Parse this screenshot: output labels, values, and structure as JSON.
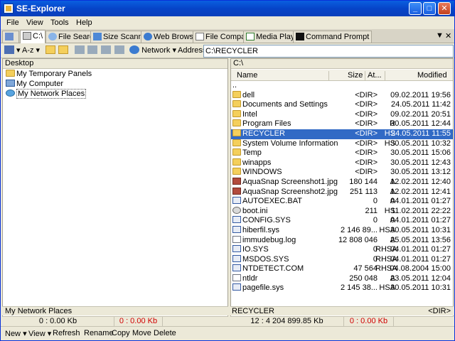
{
  "window": {
    "title": "SE-Explorer",
    "min": "_",
    "max": "□",
    "close": "✕"
  },
  "menu": [
    "File",
    "View",
    "Tools",
    "Help"
  ],
  "tabs": [
    {
      "label": "C:\\",
      "icon": "drive-icon",
      "active": true
    },
    {
      "label": "File Search",
      "icon": "search-icon"
    },
    {
      "label": "Size Scanner",
      "icon": "scanner-icon"
    },
    {
      "label": "Web Browser",
      "icon": "globe-icon"
    },
    {
      "label": "File Compare",
      "icon": "compare-icon"
    },
    {
      "label": "Media Player",
      "icon": "media-icon"
    },
    {
      "label": "Command Prompt",
      "icon": "cmd-icon"
    }
  ],
  "tabbar_controls": {
    "chevron": "▼",
    "close": "✕"
  },
  "toolbar": {
    "sort": "A-z",
    "network": "Network",
    "address_label": "Address",
    "address_value": "C:\\RECYCLER"
  },
  "left_pane": {
    "header": "Desktop",
    "items": [
      {
        "label": "My Temporary Panels",
        "icon": "folder-icon"
      },
      {
        "label": "My Computer",
        "icon": "computer-icon"
      },
      {
        "label": "My Network Places",
        "icon": "network-icon",
        "selected": true
      }
    ],
    "status_name": "My Network Places",
    "status_count": "0 : 0.00 Kb",
    "status_selected": "0 : 0.00 Kb"
  },
  "right_pane": {
    "header": "C:\\",
    "columns": {
      "name": "Name",
      "size": "Size",
      "attr": "At...",
      "modified": "Modified"
    },
    "parent": "..",
    "rows": [
      {
        "name": "dell",
        "icon": "folder",
        "size": "<DIR>",
        "attr": "",
        "modified": "09.02.2011 19:56"
      },
      {
        "name": "Documents and Settings",
        "icon": "folder",
        "size": "<DIR>",
        "attr": "",
        "modified": "24.05.2011 11:42"
      },
      {
        "name": "Intel",
        "icon": "folder",
        "size": "<DIR>",
        "attr": "",
        "modified": "09.02.2011 20:51"
      },
      {
        "name": "Program Files",
        "icon": "folder",
        "size": "<DIR>",
        "attr": "R",
        "modified": "30.05.2011 12:44"
      },
      {
        "name": "RECYCLER",
        "icon": "folder",
        "size": "<DIR>",
        "attr": "HS",
        "modified": "24.05.2011 11:55",
        "selected": true
      },
      {
        "name": "System Volume Information",
        "icon": "folder",
        "size": "<DIR>",
        "attr": "HS",
        "modified": "30.05.2011 10:32"
      },
      {
        "name": "Temp",
        "icon": "folder",
        "size": "<DIR>",
        "attr": "",
        "modified": "30.05.2011 15:06"
      },
      {
        "name": "winapps",
        "icon": "folder",
        "size": "<DIR>",
        "attr": "",
        "modified": "30.05.2011 12:43"
      },
      {
        "name": "WINDOWS",
        "icon": "folder",
        "size": "<DIR>",
        "attr": "",
        "modified": "30.05.2011 13:12"
      },
      {
        "name": "AquaSnap Screenshot1.jpg",
        "icon": "img",
        "size": "180 144",
        "attr": "A",
        "modified": "12.02.2011 12:40"
      },
      {
        "name": "AquaSnap Screenshot2.jpg",
        "icon": "img",
        "size": "251 113",
        "attr": "A",
        "modified": "12.02.2011 12:41"
      },
      {
        "name": "AUTOEXEC.BAT",
        "icon": "sys",
        "size": "0",
        "attr": "A",
        "modified": "04.01.2011 01:27"
      },
      {
        "name": "boot.ini",
        "icon": "gear",
        "size": "211",
        "attr": "HS",
        "modified": "11.02.2011 22:22"
      },
      {
        "name": "CONFIG.SYS",
        "icon": "sys",
        "size": "0",
        "attr": "A",
        "modified": "04.01.2011 01:27"
      },
      {
        "name": "hiberfil.sys",
        "icon": "sys",
        "size": "2 146 89...",
        "attr": "HSA",
        "modified": "30.05.2011 10:31"
      },
      {
        "name": "immudebug.log",
        "icon": "file",
        "size": "12 808 046",
        "attr": "A",
        "modified": "25.05.2011 13:56"
      },
      {
        "name": "IO.SYS",
        "icon": "sys",
        "size": "0",
        "attr": "RHSA",
        "modified": "04.01.2011 01:27"
      },
      {
        "name": "MSDOS.SYS",
        "icon": "sys",
        "size": "0",
        "attr": "RHSA",
        "modified": "04.01.2011 01:27"
      },
      {
        "name": "NTDETECT.COM",
        "icon": "sys",
        "size": "47 564",
        "attr": "RHSA",
        "modified": "04.08.2004 15:00"
      },
      {
        "name": "ntldr",
        "icon": "file",
        "size": "250 048",
        "attr": "A",
        "modified": "23.05.2011 12:04"
      },
      {
        "name": "pagefile.sys",
        "icon": "sys",
        "size": "2 145 38...",
        "attr": "HSA",
        "modified": "30.05.2011 10:31"
      }
    ],
    "status_name": "RECYCLER",
    "status_dir": "<DIR>",
    "status_count": "12 : 4 204 899.85 Kb",
    "status_selected": "0 : 0.00 Kb"
  },
  "bottom": {
    "new": "New",
    "view": "View",
    "refresh": "Refresh",
    "rename": "Rename",
    "copy": "Copy",
    "move": "Move",
    "delete": "Delete",
    "caret": "▾"
  },
  "colors": {
    "titlebar": "#0a5fe0",
    "selection": "#316ac5",
    "red_value": "#d00000",
    "folder": "#f4cf5c"
  }
}
